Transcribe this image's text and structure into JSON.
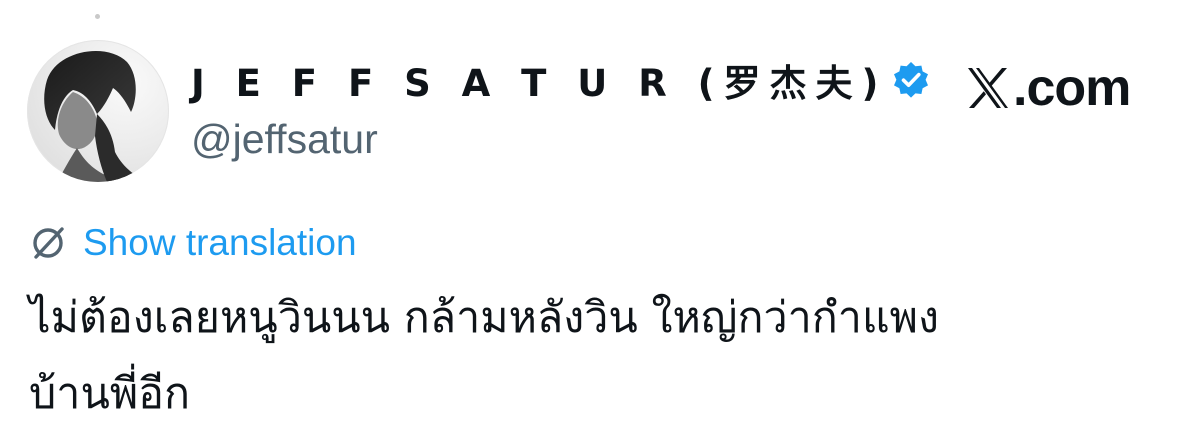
{
  "author": {
    "display_name": "J E F F S A T U R (罗杰夫)",
    "handle": "@jeffsatur",
    "verified": true
  },
  "brand": {
    "label": ".com",
    "logo_icon": "x-logo-icon"
  },
  "translation": {
    "icon": "globe-icon",
    "label": "Show translation"
  },
  "tweet": {
    "lines": [
      "ไม่ต้องเลยหนูวินนน กล้ามหลังวิน ใหญ่กว่ากำแพง",
      "บ้านพี่อีก"
    ]
  },
  "colors": {
    "link": "#1d9bf0",
    "handle": "#536471",
    "verified": "#1d9bf0",
    "text": "#0f1419"
  }
}
